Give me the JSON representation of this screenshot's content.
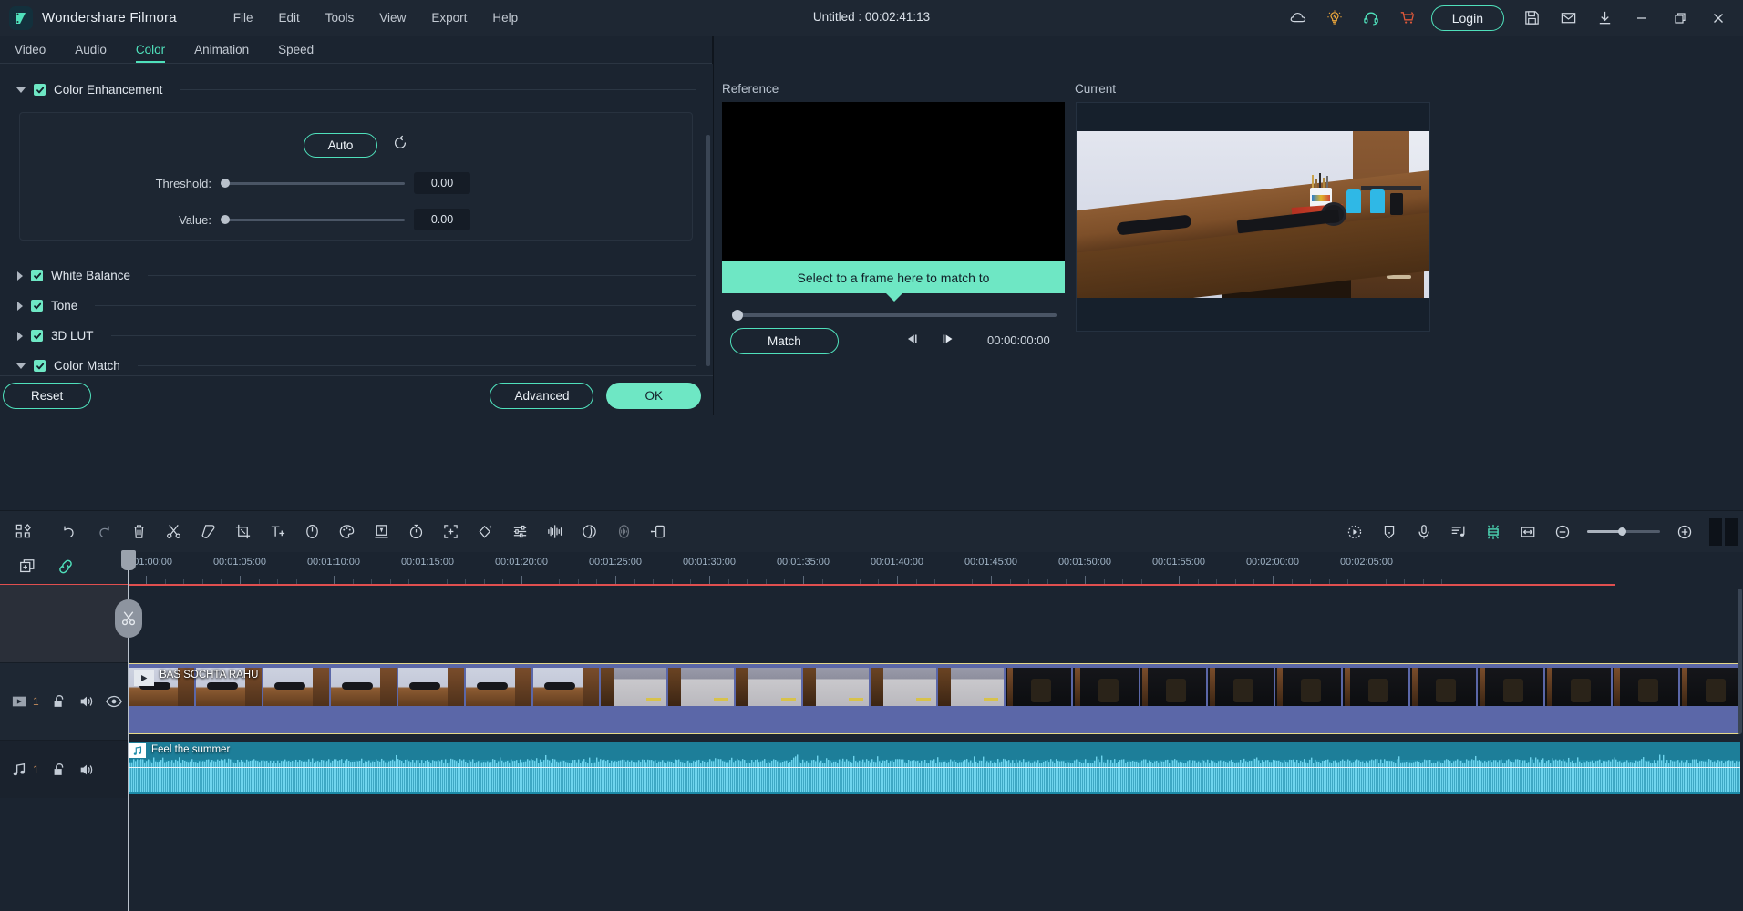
{
  "app": {
    "brand": "Wondershare Filmora",
    "document_title": "Untitled : 00:02:41:13"
  },
  "menubar": {
    "items": [
      {
        "label": "File"
      },
      {
        "label": "Edit"
      },
      {
        "label": "Tools"
      },
      {
        "label": "View"
      },
      {
        "label": "Export"
      },
      {
        "label": "Help"
      }
    ]
  },
  "titlebar_right": {
    "icons": [
      "cloud-icon",
      "lightbulb-icon",
      "headset-icon",
      "cart-icon"
    ],
    "login_label": "Login",
    "trailing_icons": [
      "save-icon",
      "mail-icon",
      "download-icon"
    ],
    "window_controls": [
      "minimize",
      "maximize",
      "close"
    ],
    "accent": "#4fe0bb"
  },
  "tabs": {
    "items": [
      {
        "label": "Video",
        "active": false
      },
      {
        "label": "Audio",
        "active": false
      },
      {
        "label": "Color",
        "active": true
      },
      {
        "label": "Animation",
        "active": false
      },
      {
        "label": "Speed",
        "active": false
      }
    ],
    "active_color": "#4fe0bb"
  },
  "properties": {
    "sections": [
      {
        "label": "Color Enhancement",
        "expanded": true,
        "checked": true
      },
      {
        "label": "White Balance",
        "expanded": false,
        "checked": true
      },
      {
        "label": "Tone",
        "expanded": false,
        "checked": true
      },
      {
        "label": "3D LUT",
        "expanded": false,
        "checked": true
      },
      {
        "label": "Color Match",
        "expanded": true,
        "checked": true
      }
    ],
    "color_enhancement": {
      "auto_label": "Auto",
      "reset_icon": "reset-arrow-icon",
      "sliders": [
        {
          "label": "Threshold:",
          "value": "0.00",
          "position": 0
        },
        {
          "label": "Value:",
          "value": "0.00",
          "position": 0
        }
      ]
    }
  },
  "action_bar": {
    "reset_label": "Reset",
    "advanced_label": "Advanced",
    "ok_label": "OK"
  },
  "preview": {
    "reference_label": "Reference",
    "current_label": "Current",
    "reference_banner": "Select to a frame here to match to",
    "match_label": "Match",
    "timecode": "00:00:00:00",
    "slider_position": 0,
    "prev_frame_icon": "step-back-icon",
    "next_frame_icon": "step-forward-icon"
  },
  "toolbar": {
    "left_icons": [
      "media-grid-icon",
      "undo-icon",
      "redo-icon",
      "delete-icon",
      "split-scissors-icon",
      "marker-icon",
      "crop-icon",
      "text-add-icon",
      "speed-icon",
      "color-palette-icon",
      "green-screen-icon",
      "stopwatch-icon",
      "motion-tracking-icon",
      "mask-icon",
      "adjust-sliders-icon",
      "audio-mix-icon",
      "audio-detach-icon",
      "silence-detect-icon",
      "keyframe-icon"
    ],
    "right_icons": [
      "render-preview-icon",
      "marker-add-icon",
      "record-voiceover-icon",
      "audio-beat-icon",
      "snapshot-icon",
      "fit-timeline-icon"
    ],
    "zoom_out_icon": "zoom-out-icon",
    "zoom_in_icon": "zoom-in-icon",
    "zoom_level": 45
  },
  "timeline": {
    "header_icons": [
      "duplicate-track-icon",
      "link-icon"
    ],
    "ruler_ticks": [
      "00:01:00:00",
      "00:01:05:00",
      "00:01:10:00",
      "00:01:15:00",
      "00:01:20:00",
      "00:01:25:00",
      "00:01:30:00",
      "00:01:35:00",
      "00:01:40:00",
      "00:01:45:00",
      "00:01:50:00",
      "00:01:55:00",
      "00:02:00:00",
      "00:02:05:00"
    ],
    "tracks": [
      {
        "type": "video",
        "number": "1",
        "controls": [
          "play-track-icon",
          "lock-icon",
          "mute-icon",
          "eye-icon"
        ],
        "clip": {
          "title": "BAS SOCHTA RAHU",
          "selected": true
        }
      },
      {
        "type": "audio",
        "number": "1",
        "controls": [
          "music-note-icon",
          "lock-icon",
          "mute-icon"
        ],
        "clip": {
          "title": "Feel the summer",
          "selected": false
        }
      }
    ],
    "playhead_icon": "scissors-icon"
  }
}
